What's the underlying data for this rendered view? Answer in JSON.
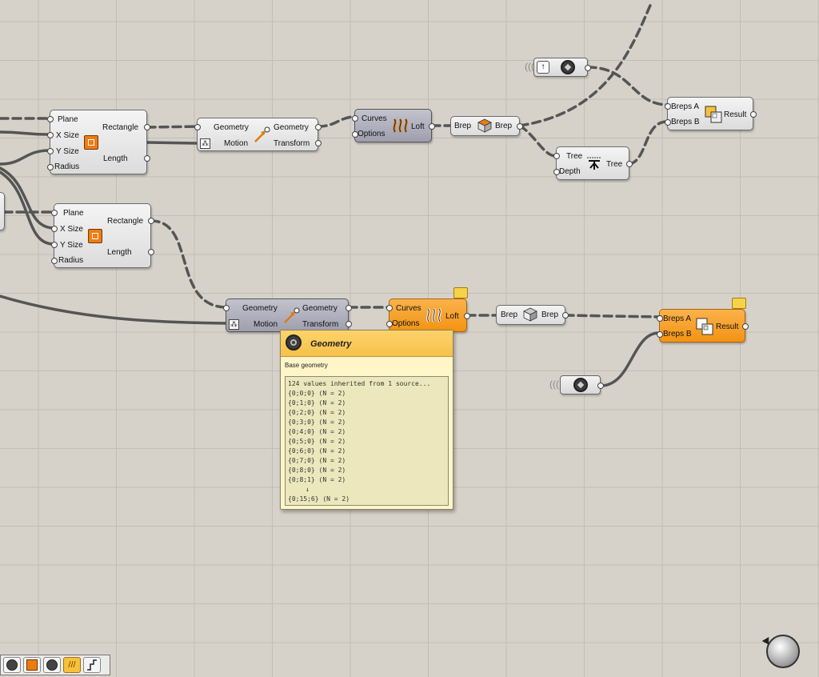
{
  "canvas": {
    "background": "#d6d2ca",
    "grid_color": "#c2beb6"
  },
  "rect1": {
    "inputs": [
      "Plane",
      "X Size",
      "Y Size",
      "Radius"
    ],
    "outputs": [
      "Rectangle",
      "Length"
    ],
    "icon": "rectangle-icon"
  },
  "rect2": {
    "inputs": [
      "Plane",
      "X Size",
      "Y Size",
      "Radius"
    ],
    "outputs": [
      "Rectangle",
      "Length"
    ],
    "icon": "rectangle-icon"
  },
  "move1": {
    "inputs": [
      "Geometry",
      "Motion"
    ],
    "outputs": [
      "Geometry",
      "Transform"
    ],
    "icon": "move-arrow-icon"
  },
  "move2": {
    "inputs": [
      "Geometry",
      "Motion"
    ],
    "outputs": [
      "Geometry",
      "Transform"
    ],
    "icon": "move-arrow-icon"
  },
  "loft1": {
    "inputs": [
      "Curves",
      "Options"
    ],
    "outputs": [
      "Loft"
    ],
    "icon": "loft-icon"
  },
  "loft2": {
    "inputs": [
      "Curves",
      "Options"
    ],
    "outputs": [
      "Loft"
    ],
    "icon": "loft-icon",
    "state": "warning",
    "color": "#f39312"
  },
  "brep1": {
    "input": "Brep",
    "output": "Brep",
    "icon": "brep-icon"
  },
  "brep2": {
    "input": "Brep",
    "output": "Brep",
    "icon": "brep-icon"
  },
  "tree": {
    "inputs": [
      "Tree",
      "Depth"
    ],
    "outputs": [
      "Tree"
    ],
    "icon": "tree-icon"
  },
  "union1": {
    "inputs": [
      "Breps A",
      "Breps B"
    ],
    "outputs": [
      "Result"
    ],
    "icon": "solid-union-icon"
  },
  "union2": {
    "inputs": [
      "Breps A",
      "Breps B"
    ],
    "outputs": [
      "Result"
    ],
    "icon": "solid-union-icon",
    "state": "warning",
    "color": "#f39312"
  },
  "tooltip": {
    "title": "Geometry",
    "description": "Base geometry",
    "header": "124 values inherited from 1 source...",
    "lines": [
      "{0;0;0} (N = 2)",
      "{0;1;0} (N = 2)",
      "{0;2;0} (N = 2)",
      "{0;3;0} (N = 2)",
      "{0;4;0} (N = 2)",
      "{0;5;0} (N = 2)",
      "{0;6;0} (N = 2)",
      "{0;7;0} (N = 2)",
      "{0;8;0} (N = 2)",
      "{0;8;1} (N = 2)"
    ],
    "ellipsis": "↓",
    "last_line": "{0;15;6} (N = 2)",
    "icon": "geometry-param-icon"
  },
  "toolbar": {
    "buttons": [
      "curve-icon",
      "rectangle-icon",
      "geometry-icon",
      "loft-active-icon",
      "polyline-icon"
    ]
  },
  "navigation": {
    "icon": "navigation-wheel-icon"
  }
}
